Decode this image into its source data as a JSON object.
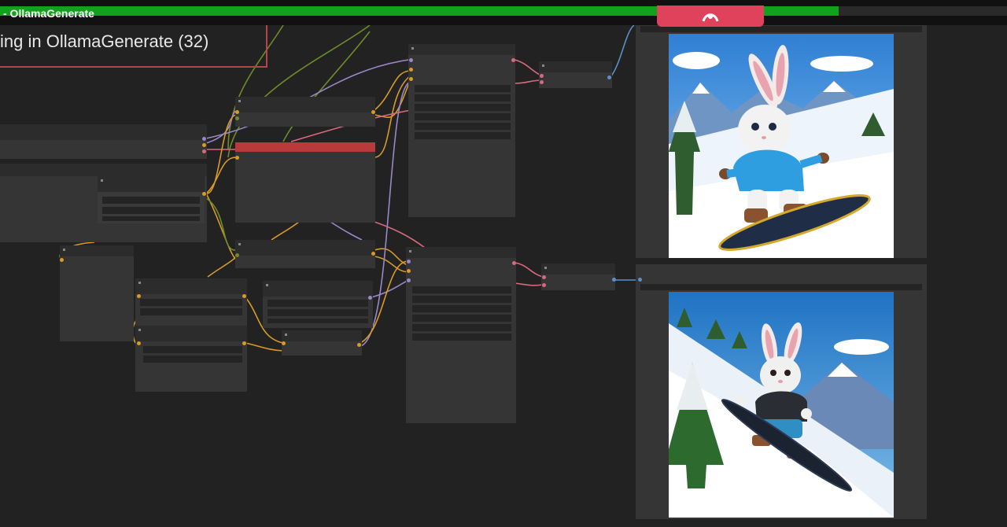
{
  "app": {
    "window_title": "- OllamaGenerate",
    "progress": 0.833
  },
  "banner": {
    "text": "ing in OllamaGenerate (32)"
  },
  "colors": {
    "progress": "#12a11c",
    "pink_button": "#e0425c",
    "error_node": "#b83a3a",
    "node_bg": "#353535",
    "canvas_bg": "#222222"
  },
  "icons": {
    "pink_button_icon": "wave-icon"
  },
  "outputs": [
    {
      "name": "output-image-1",
      "subject": "bunny in blue jacket on snowboard"
    },
    {
      "name": "output-image-2",
      "subject": "bunny in black jacket on snowboard"
    }
  ]
}
